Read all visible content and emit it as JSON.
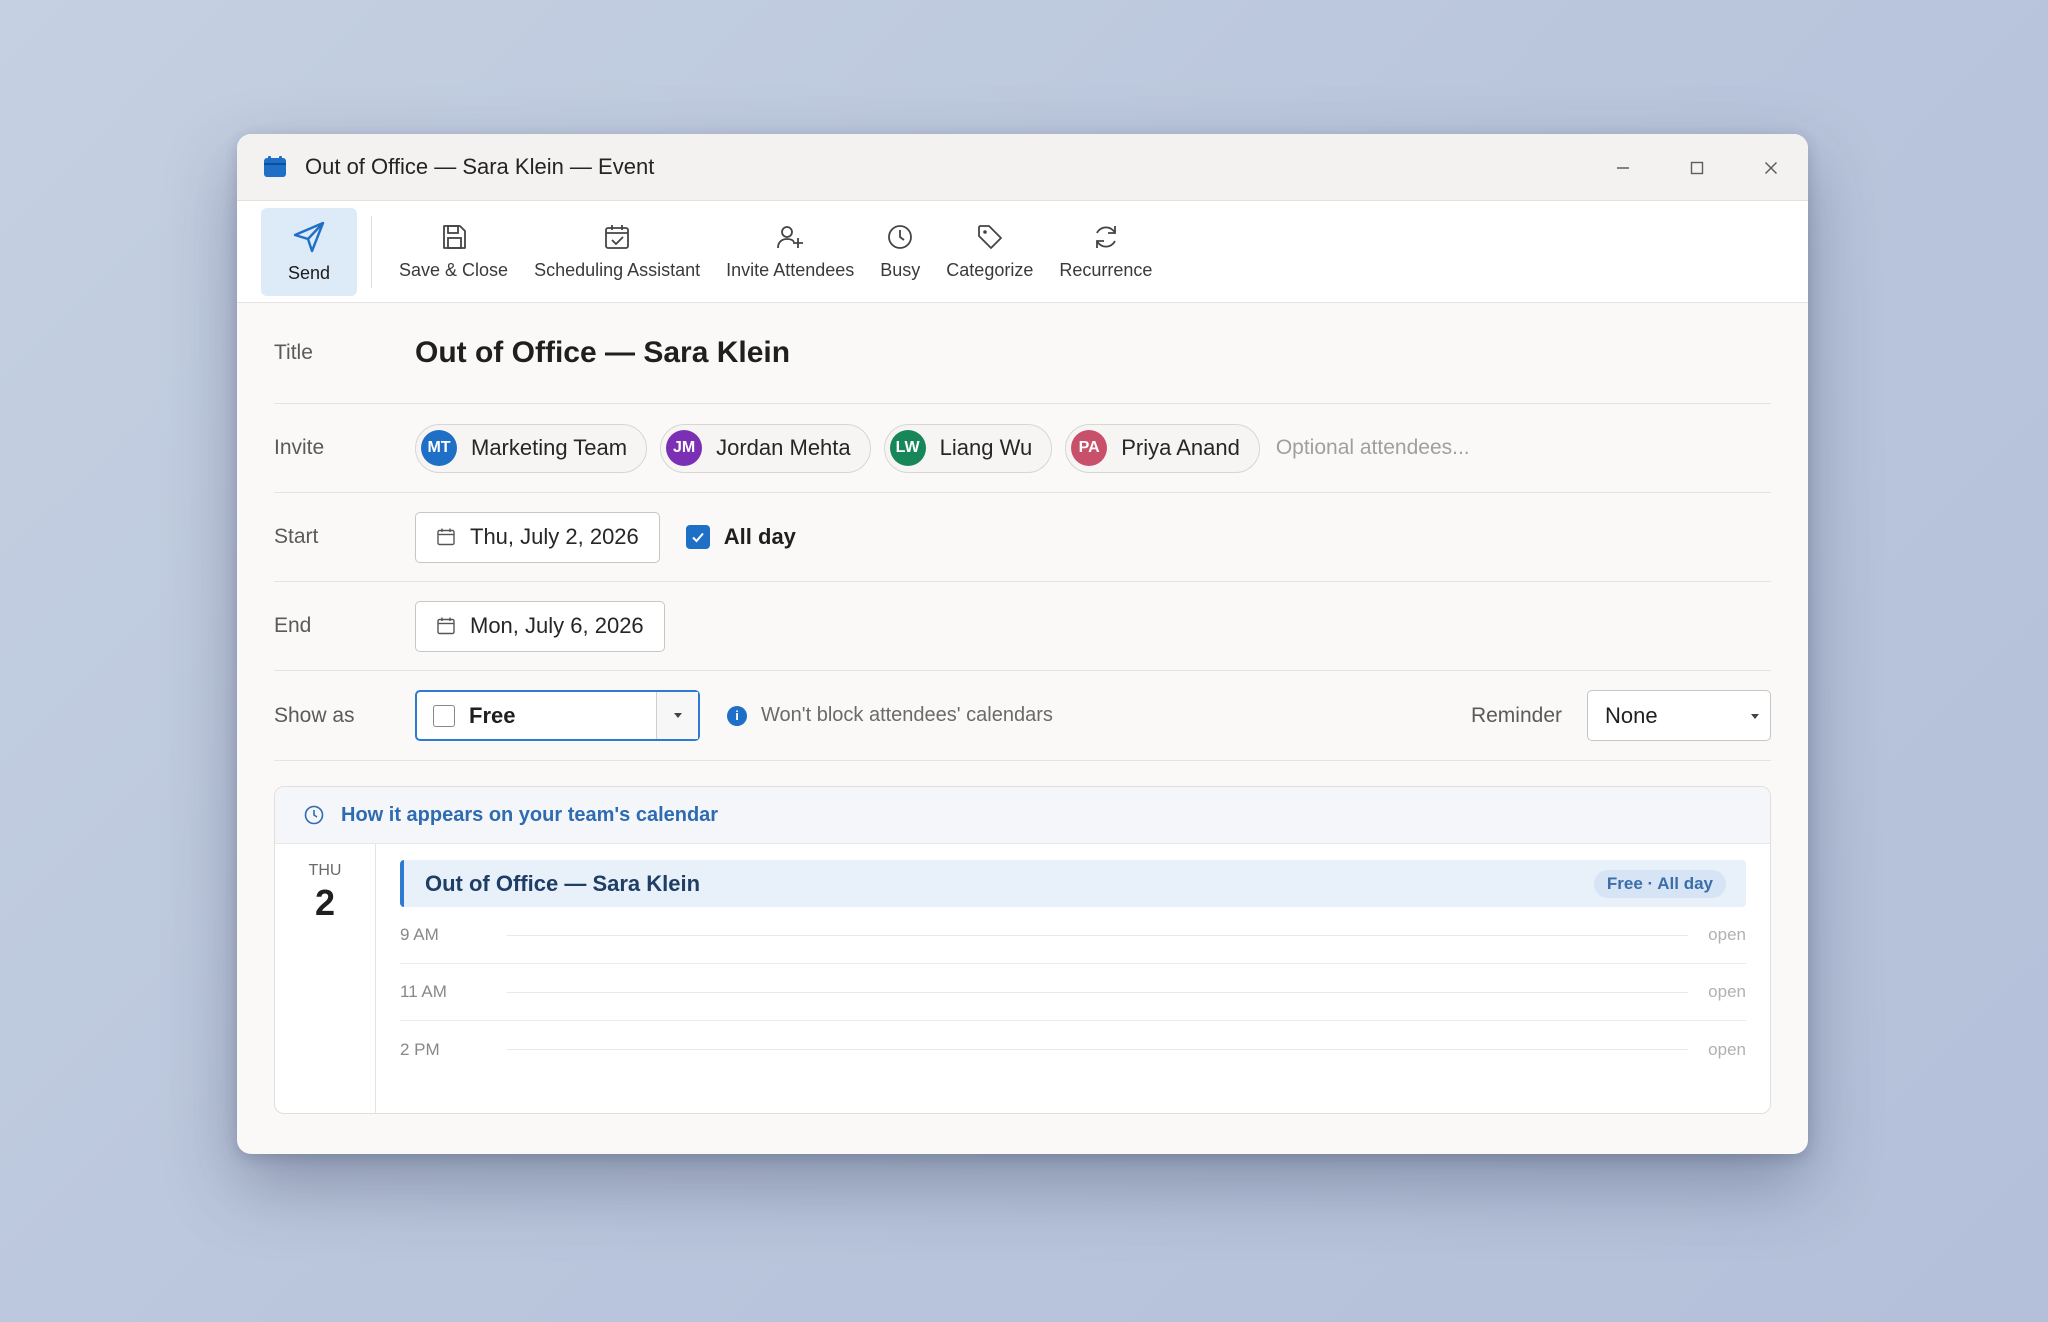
{
  "window": {
    "title": "Out of Office — Sara Klein — Event"
  },
  "toolbar": {
    "send": "Send",
    "save_close": "Save & Close",
    "scheduling": "Scheduling Assistant",
    "invite": "Invite Attendees",
    "busy": "Busy",
    "categorize": "Categorize",
    "recurrence": "Recurrence"
  },
  "form": {
    "title_label": "Title",
    "title_value": "Out of Office — Sara Klein",
    "invite_label": "Invite",
    "attendees": [
      {
        "initials": "MT",
        "name": "Marketing Team",
        "color": "#1e6fc5"
      },
      {
        "initials": "JM",
        "name": "Jordan Mehta",
        "color": "#7a2fb5"
      },
      {
        "initials": "LW",
        "name": "Liang Wu",
        "color": "#17875a"
      },
      {
        "initials": "PA",
        "name": "Priya Anand",
        "color": "#c9506a"
      }
    ],
    "optional_placeholder": "Optional attendees...",
    "start_label": "Start",
    "start_date": "Thu, July 2, 2026",
    "all_day_label": "All day",
    "all_day_checked": true,
    "end_label": "End",
    "end_date": "Mon, July 6, 2026",
    "show_as_label": "Show as",
    "show_as_value": "Free",
    "show_as_info": "Won't block attendees' calendars",
    "reminder_label": "Reminder",
    "reminder_value": "None"
  },
  "preview": {
    "heading": "How it appears on your team's calendar",
    "day_of_week": "THU",
    "day_number": "2",
    "event_title": "Out of Office — Sara Klein",
    "event_badge": "Free · All day",
    "slots": [
      {
        "time": "9 AM",
        "status": "open"
      },
      {
        "time": "11 AM",
        "status": "open"
      },
      {
        "time": "2 PM",
        "status": "open"
      }
    ]
  },
  "colors": {
    "accent": "#1e6fc5",
    "send_bg": "#ddebf8"
  }
}
